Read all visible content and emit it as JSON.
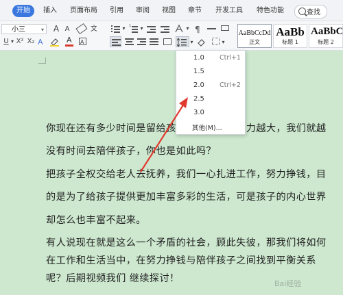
{
  "menubar": {
    "tabs": [
      "开始",
      "插入",
      "页面布局",
      "引用",
      "审阅",
      "视图",
      "章节",
      "开发工具",
      "特色功能"
    ],
    "search_label": "查找"
  },
  "ribbon": {
    "font_size": "小三",
    "font_size_chevron": "▾",
    "grow_font": "A",
    "shrink_font": "A",
    "underline": "U",
    "superscript": "X²",
    "subscript": "X₂",
    "strikethrough": "A",
    "font_color_letter": "A",
    "style_cards": [
      {
        "sample": "AaBbCcDd",
        "name": "正文"
      },
      {
        "sample": "AaBb",
        "name": "标题 1"
      },
      {
        "sample": "AaBbC",
        "name": "标题 2"
      }
    ]
  },
  "line_spacing_menu": {
    "options": [
      {
        "value": "1.0",
        "shortcut": "Ctrl+1"
      },
      {
        "value": "1.5",
        "shortcut": ""
      },
      {
        "value": "2.0",
        "shortcut": "Ctrl+2"
      },
      {
        "value": "2.5",
        "shortcut": ""
      },
      {
        "value": "3.0",
        "shortcut": ""
      }
    ],
    "other": "其他(M)...",
    "accent_color": "#e03a2f"
  },
  "document": {
    "lines": [
      "你现在还有多少时间是留给孩子的？当你的压力越大，我们就越",
      "没有时间去陪伴孩子，你也是如此吗？",
      "把孩子全权交给老人去抚养，我们一心扎进工作，努力挣钱，目",
      "的是为了给孩子提供更加丰富多彩的生活，可是孩子的内心世界",
      "却怎么也丰富不起来。",
      "有人说现在就是这么一个矛盾的社会，顾此失彼，那我们将如何",
      "在工作和生活当中，在努力挣钱与陪伴孩子之间找到平衡关系",
      "呢？后期视频我们 继续探讨！"
    ]
  },
  "watermark": "Bai经验"
}
